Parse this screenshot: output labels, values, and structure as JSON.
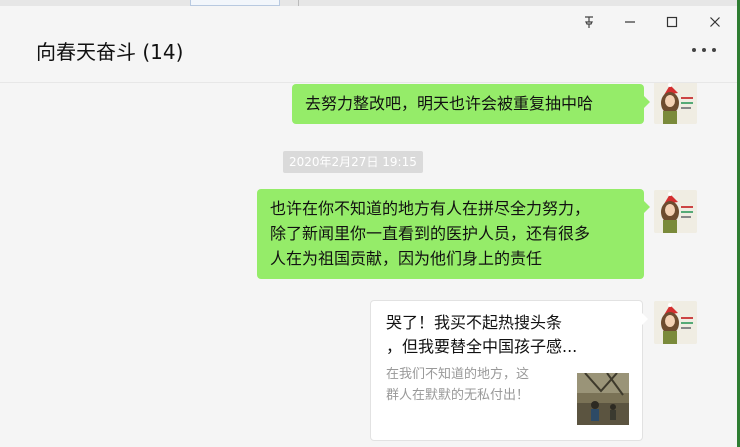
{
  "window": {
    "title": "向春天奋斗 (14)",
    "controls": [
      "pin",
      "minimize",
      "maximize",
      "close"
    ]
  },
  "messages": [
    {
      "type": "text",
      "side": "right",
      "text": "去努力整改吧，明天也许会被重复抽中哈"
    },
    {
      "type": "timestamp",
      "text": "2020年2月27日 19:15"
    },
    {
      "type": "text",
      "side": "right",
      "lines": [
        "也许在你不知道的地方有人在拼尽全力努力，",
        "除了新闻里你一直看到的医护人员，还有很多",
        "人在为祖国贡献，因为他们身上的责任"
      ]
    },
    {
      "type": "link-card",
      "side": "right",
      "title_lines": [
        "哭了！我买不起热搜头条",
        "，但我要替全中国孩子感..."
      ],
      "desc_lines": [
        "在我们不知道的地方，这",
        "群人在默默的无私付出！"
      ]
    }
  ],
  "colors": {
    "bubble": "#95ec69",
    "background": "#f5f5f5"
  }
}
